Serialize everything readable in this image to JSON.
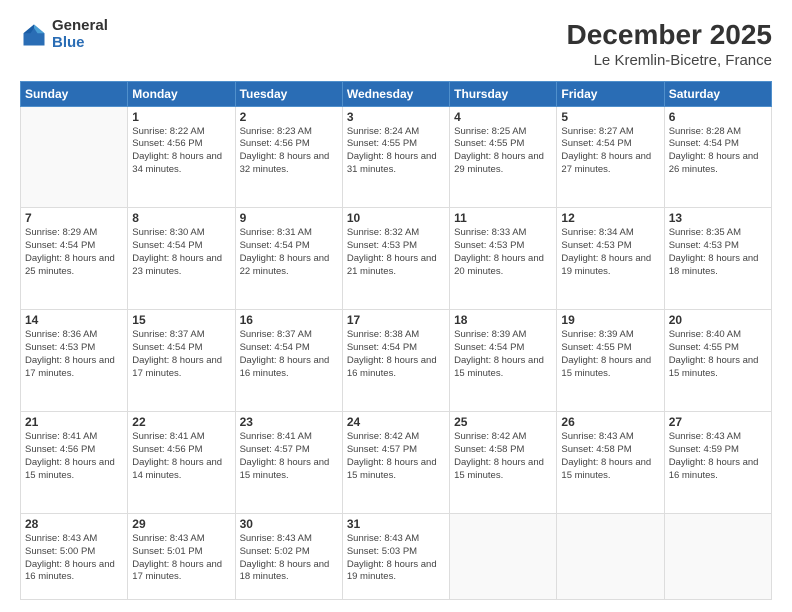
{
  "logo": {
    "general": "General",
    "blue": "Blue"
  },
  "header": {
    "title": "December 2025",
    "subtitle": "Le Kremlin-Bicetre, France"
  },
  "weekdays": [
    "Sunday",
    "Monday",
    "Tuesday",
    "Wednesday",
    "Thursday",
    "Friday",
    "Saturday"
  ],
  "weeks": [
    [
      {
        "day": "",
        "sunrise": "",
        "sunset": "",
        "daylight": ""
      },
      {
        "day": "1",
        "sunrise": "Sunrise: 8:22 AM",
        "sunset": "Sunset: 4:56 PM",
        "daylight": "Daylight: 8 hours and 34 minutes."
      },
      {
        "day": "2",
        "sunrise": "Sunrise: 8:23 AM",
        "sunset": "Sunset: 4:56 PM",
        "daylight": "Daylight: 8 hours and 32 minutes."
      },
      {
        "day": "3",
        "sunrise": "Sunrise: 8:24 AM",
        "sunset": "Sunset: 4:55 PM",
        "daylight": "Daylight: 8 hours and 31 minutes."
      },
      {
        "day": "4",
        "sunrise": "Sunrise: 8:25 AM",
        "sunset": "Sunset: 4:55 PM",
        "daylight": "Daylight: 8 hours and 29 minutes."
      },
      {
        "day": "5",
        "sunrise": "Sunrise: 8:27 AM",
        "sunset": "Sunset: 4:54 PM",
        "daylight": "Daylight: 8 hours and 27 minutes."
      },
      {
        "day": "6",
        "sunrise": "Sunrise: 8:28 AM",
        "sunset": "Sunset: 4:54 PM",
        "daylight": "Daylight: 8 hours and 26 minutes."
      }
    ],
    [
      {
        "day": "7",
        "sunrise": "Sunrise: 8:29 AM",
        "sunset": "Sunset: 4:54 PM",
        "daylight": "Daylight: 8 hours and 25 minutes."
      },
      {
        "day": "8",
        "sunrise": "Sunrise: 8:30 AM",
        "sunset": "Sunset: 4:54 PM",
        "daylight": "Daylight: 8 hours and 23 minutes."
      },
      {
        "day": "9",
        "sunrise": "Sunrise: 8:31 AM",
        "sunset": "Sunset: 4:54 PM",
        "daylight": "Daylight: 8 hours and 22 minutes."
      },
      {
        "day": "10",
        "sunrise": "Sunrise: 8:32 AM",
        "sunset": "Sunset: 4:53 PM",
        "daylight": "Daylight: 8 hours and 21 minutes."
      },
      {
        "day": "11",
        "sunrise": "Sunrise: 8:33 AM",
        "sunset": "Sunset: 4:53 PM",
        "daylight": "Daylight: 8 hours and 20 minutes."
      },
      {
        "day": "12",
        "sunrise": "Sunrise: 8:34 AM",
        "sunset": "Sunset: 4:53 PM",
        "daylight": "Daylight: 8 hours and 19 minutes."
      },
      {
        "day": "13",
        "sunrise": "Sunrise: 8:35 AM",
        "sunset": "Sunset: 4:53 PM",
        "daylight": "Daylight: 8 hours and 18 minutes."
      }
    ],
    [
      {
        "day": "14",
        "sunrise": "Sunrise: 8:36 AM",
        "sunset": "Sunset: 4:53 PM",
        "daylight": "Daylight: 8 hours and 17 minutes."
      },
      {
        "day": "15",
        "sunrise": "Sunrise: 8:37 AM",
        "sunset": "Sunset: 4:54 PM",
        "daylight": "Daylight: 8 hours and 17 minutes."
      },
      {
        "day": "16",
        "sunrise": "Sunrise: 8:37 AM",
        "sunset": "Sunset: 4:54 PM",
        "daylight": "Daylight: 8 hours and 16 minutes."
      },
      {
        "day": "17",
        "sunrise": "Sunrise: 8:38 AM",
        "sunset": "Sunset: 4:54 PM",
        "daylight": "Daylight: 8 hours and 16 minutes."
      },
      {
        "day": "18",
        "sunrise": "Sunrise: 8:39 AM",
        "sunset": "Sunset: 4:54 PM",
        "daylight": "Daylight: 8 hours and 15 minutes."
      },
      {
        "day": "19",
        "sunrise": "Sunrise: 8:39 AM",
        "sunset": "Sunset: 4:55 PM",
        "daylight": "Daylight: 8 hours and 15 minutes."
      },
      {
        "day": "20",
        "sunrise": "Sunrise: 8:40 AM",
        "sunset": "Sunset: 4:55 PM",
        "daylight": "Daylight: 8 hours and 15 minutes."
      }
    ],
    [
      {
        "day": "21",
        "sunrise": "Sunrise: 8:41 AM",
        "sunset": "Sunset: 4:56 PM",
        "daylight": "Daylight: 8 hours and 15 minutes."
      },
      {
        "day": "22",
        "sunrise": "Sunrise: 8:41 AM",
        "sunset": "Sunset: 4:56 PM",
        "daylight": "Daylight: 8 hours and 14 minutes."
      },
      {
        "day": "23",
        "sunrise": "Sunrise: 8:41 AM",
        "sunset": "Sunset: 4:57 PM",
        "daylight": "Daylight: 8 hours and 15 minutes."
      },
      {
        "day": "24",
        "sunrise": "Sunrise: 8:42 AM",
        "sunset": "Sunset: 4:57 PM",
        "daylight": "Daylight: 8 hours and 15 minutes."
      },
      {
        "day": "25",
        "sunrise": "Sunrise: 8:42 AM",
        "sunset": "Sunset: 4:58 PM",
        "daylight": "Daylight: 8 hours and 15 minutes."
      },
      {
        "day": "26",
        "sunrise": "Sunrise: 8:43 AM",
        "sunset": "Sunset: 4:58 PM",
        "daylight": "Daylight: 8 hours and 15 minutes."
      },
      {
        "day": "27",
        "sunrise": "Sunrise: 8:43 AM",
        "sunset": "Sunset: 4:59 PM",
        "daylight": "Daylight: 8 hours and 16 minutes."
      }
    ],
    [
      {
        "day": "28",
        "sunrise": "Sunrise: 8:43 AM",
        "sunset": "Sunset: 5:00 PM",
        "daylight": "Daylight: 8 hours and 16 minutes."
      },
      {
        "day": "29",
        "sunrise": "Sunrise: 8:43 AM",
        "sunset": "Sunset: 5:01 PM",
        "daylight": "Daylight: 8 hours and 17 minutes."
      },
      {
        "day": "30",
        "sunrise": "Sunrise: 8:43 AM",
        "sunset": "Sunset: 5:02 PM",
        "daylight": "Daylight: 8 hours and 18 minutes."
      },
      {
        "day": "31",
        "sunrise": "Sunrise: 8:43 AM",
        "sunset": "Sunset: 5:03 PM",
        "daylight": "Daylight: 8 hours and 19 minutes."
      },
      {
        "day": "",
        "sunrise": "",
        "sunset": "",
        "daylight": ""
      },
      {
        "day": "",
        "sunrise": "",
        "sunset": "",
        "daylight": ""
      },
      {
        "day": "",
        "sunrise": "",
        "sunset": "",
        "daylight": ""
      }
    ]
  ]
}
